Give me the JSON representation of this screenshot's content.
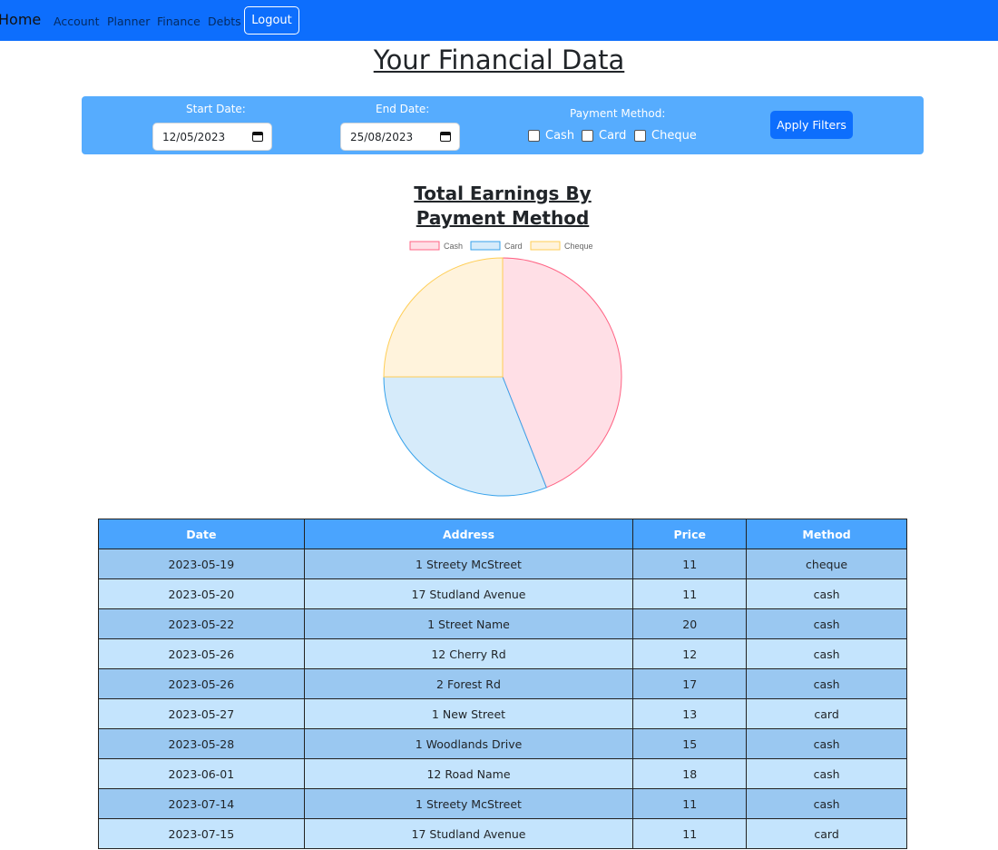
{
  "nav": {
    "brand": "Home",
    "links": [
      "Account",
      "Planner",
      "Finance",
      "Debts"
    ],
    "logout": "Logout"
  },
  "page": {
    "title": "Your Financial Data"
  },
  "filters": {
    "start_label": "Start Date:",
    "start_value": "12/05/2023",
    "end_label": "End Date:",
    "end_value": "25/08/2023",
    "payment_label": "Payment Method:",
    "methods": [
      "Cash",
      "Card",
      "Cheque"
    ],
    "apply": "Apply Filters"
  },
  "chart_data": {
    "type": "pie",
    "title": "Total Earnings By Payment Method",
    "labels": [
      "Cash",
      "Card",
      "Cheque"
    ],
    "values": [
      44,
      31,
      25
    ],
    "colors": {
      "fill": [
        "#ffdfe6",
        "#d6ebfa",
        "#fff3dc"
      ],
      "border": [
        "#ff6384",
        "#36a2eb",
        "#ffce56"
      ]
    },
    "legend": "top"
  },
  "table": {
    "columns": [
      "Date",
      "Address",
      "Price",
      "Method"
    ],
    "rows": [
      [
        "2023-05-19",
        "1 Streety McStreet",
        "11",
        "cheque"
      ],
      [
        "2023-05-20",
        "17 Studland Avenue",
        "11",
        "cash"
      ],
      [
        "2023-05-22",
        "1 Street Name",
        "20",
        "cash"
      ],
      [
        "2023-05-26",
        "12 Cherry Rd",
        "12",
        "cash"
      ],
      [
        "2023-05-26",
        "2 Forest Rd",
        "17",
        "cash"
      ],
      [
        "2023-05-27",
        "1 New Street",
        "13",
        "card"
      ],
      [
        "2023-05-28",
        "1 Woodlands Drive",
        "15",
        "cash"
      ],
      [
        "2023-06-01",
        "12 Road Name",
        "18",
        "cash"
      ],
      [
        "2023-07-14",
        "1 Streety McStreet",
        "11",
        "cash"
      ],
      [
        "2023-07-15",
        "17 Studland Avenue",
        "11",
        "card"
      ]
    ]
  }
}
